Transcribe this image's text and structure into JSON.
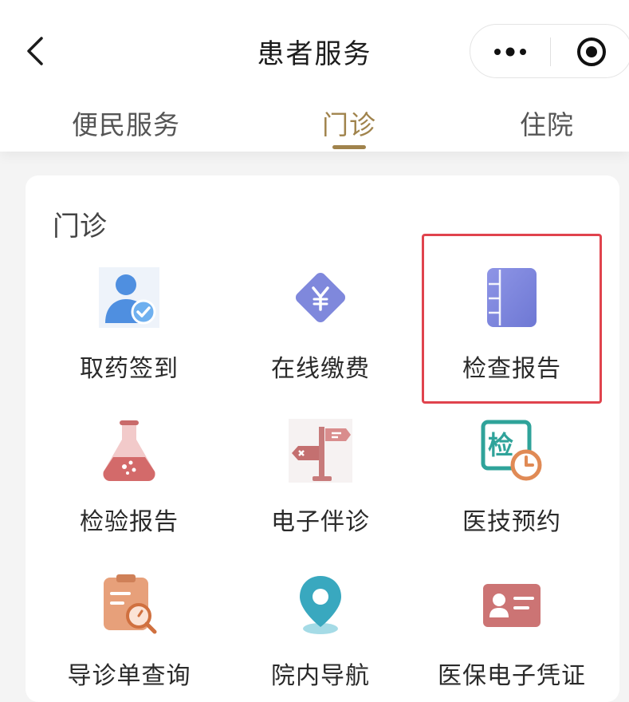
{
  "navbar": {
    "title": "患者服务",
    "back_icon": "chevron-left-icon",
    "more_icon": "more-dots-icon",
    "target_icon": "target-icon"
  },
  "tabs": [
    {
      "label": "便民服务",
      "active": false
    },
    {
      "label": "门诊",
      "active": true
    },
    {
      "label": "住院",
      "active": false
    }
  ],
  "section": {
    "title": "门诊",
    "items": [
      {
        "label": "取药签到",
        "icon": "user-check-icon",
        "highlighted": false
      },
      {
        "label": "在线缴费",
        "icon": "yen-payment-icon",
        "highlighted": false
      },
      {
        "label": "检查报告",
        "icon": "report-book-icon",
        "highlighted": true
      },
      {
        "label": "检验报告",
        "icon": "lab-flask-icon",
        "highlighted": false
      },
      {
        "label": "电子伴诊",
        "icon": "signpost-icon",
        "highlighted": false
      },
      {
        "label": "医技预约",
        "icon": "exam-clock-icon",
        "icon_text": "检",
        "highlighted": false
      },
      {
        "label": "导诊单查询",
        "icon": "clipboard-search-icon",
        "highlighted": false
      },
      {
        "label": "院内导航",
        "icon": "location-pin-icon",
        "highlighted": false
      },
      {
        "label": "医保电子凭证",
        "icon": "id-card-icon",
        "highlighted": false
      }
    ]
  },
  "colors": {
    "accent": "#a0834c",
    "highlight_border": "#e0434d"
  }
}
